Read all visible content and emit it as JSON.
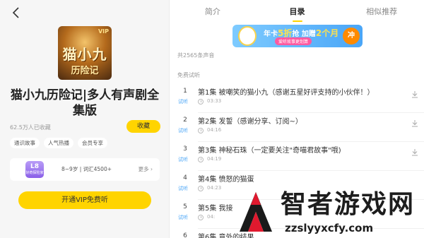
{
  "book": {
    "cover_vip": "VIP",
    "cover_title_line1": "猫小九",
    "cover_title_line2": "历险记",
    "title": "猫小九历险记|多人有声剧全集版",
    "collect_count": "62.5万人已收藏",
    "collect_label": "收藏",
    "tags": [
      "通识故事",
      "人气热播",
      "会员专享"
    ],
    "level_badge": "L8",
    "level_badge_sub": "好奇探险家",
    "level_desc": "8~9岁 | 词汇4500+",
    "level_more": "更多 ›",
    "vip_button": "开通VIP免费听"
  },
  "tabs": [
    {
      "label": "简介"
    },
    {
      "label": "目录"
    },
    {
      "label": "相似推荐"
    }
  ],
  "banner": {
    "prefix": "年卡",
    "highlight1": "5折",
    "mid": "抢 加赠",
    "highlight2": "2个月",
    "sub": "爱听故事更划算",
    "rush": "冲"
  },
  "catalog": {
    "total": "共2565条声音",
    "trial_section": "免费试听",
    "trial_tag": "试听",
    "episodes": [
      {
        "num": "1",
        "title": "第1集 被嘲笑的猫小九（感谢五星好评支持的小伙伴！）",
        "duration": "03:33"
      },
      {
        "num": "2",
        "title": "第2集 发誓（感谢分享、订阅~）",
        "duration": "04:16"
      },
      {
        "num": "3",
        "title": "第3集 神秘石珠（一定要关注\"奇喵君故事\"哦)",
        "duration": "04:19"
      },
      {
        "num": "4",
        "title": "第4集 愤怒的猫蛋",
        "duration": "04:23"
      },
      {
        "num": "5",
        "title": "第5集 我接",
        "duration": "04:"
      },
      {
        "num": "6",
        "title": "第6集 意外的结果",
        "duration": ""
      }
    ]
  },
  "watermark": {
    "title": "智者游戏网",
    "url": "zzslyyxcfy.com"
  },
  "colors": {
    "accent": "#ffd400",
    "trial": "#4aa6f7",
    "level": "#8a5fe8"
  }
}
